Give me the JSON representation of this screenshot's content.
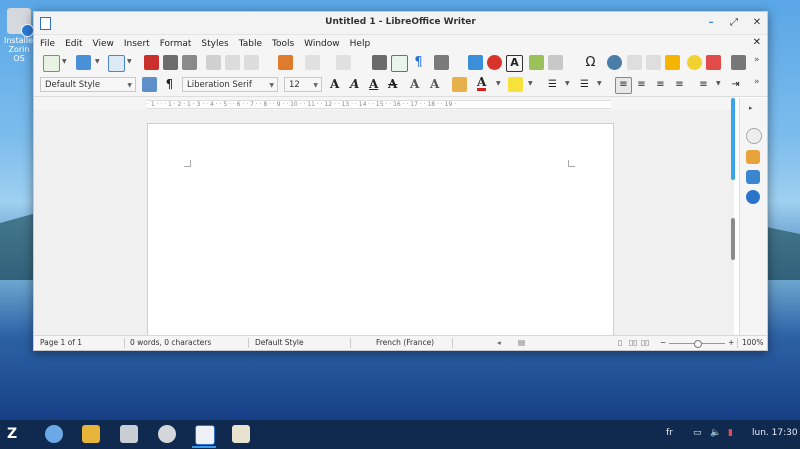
{
  "desktop": {
    "icon_label": "Installer Zorin OS"
  },
  "window": {
    "title": "Untitled 1 - LibreOffice Writer",
    "min_label": "–",
    "max_label": "⤢",
    "close_label": "✕"
  },
  "menubar": {
    "items": [
      "File",
      "Edit",
      "View",
      "Insert",
      "Format",
      "Styles",
      "Table",
      "Tools",
      "Window",
      "Help"
    ],
    "doc_close": "✕"
  },
  "formatting": {
    "paragraph_style": "Default Style",
    "font_name": "Liberation Serif",
    "font_size": "12"
  },
  "ruler": {
    "marks": "· 1 · · · 1 · 2 · 1 · 3 · · 4 · · 5 · · 6 · · 7 · · 8 · · 9 · · 10 · · 11 · · 12 · · 13 · · 14 · · 15 · · 16 · · 17 · · 18 · · 19 ·"
  },
  "statusbar": {
    "page": "Page 1 of 1",
    "words": "0 words, 0 characters",
    "page_style": "Default Style",
    "language": "French (France)",
    "zoom": "100%",
    "zoom_minus": "−",
    "zoom_plus": "+"
  },
  "taskbar": {
    "keyboard_layout": "fr",
    "clock": "lun. 17:30"
  },
  "colors": {
    "accent": "#2a86d9",
    "taskbar": "#0f2a4e"
  }
}
